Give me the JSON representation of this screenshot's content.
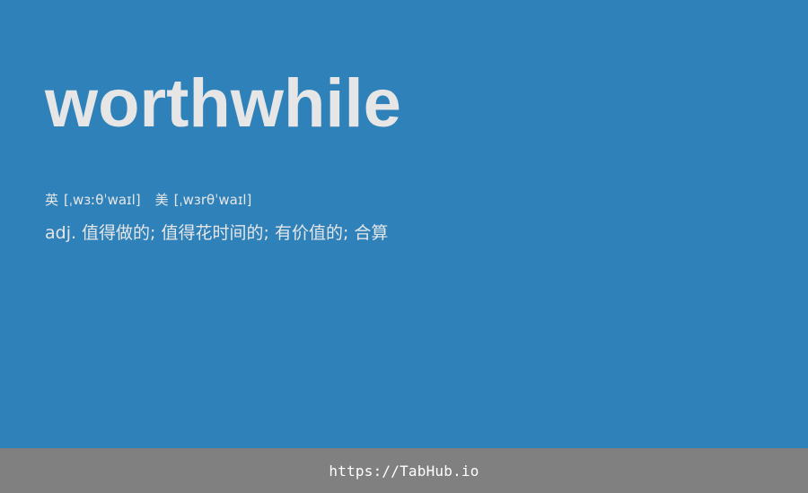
{
  "colors": {
    "background": "#2e81b9",
    "text": "#e6e6e6",
    "footer_background": "#808080",
    "footer_text": "#ffffff"
  },
  "entry": {
    "word": "worthwhile",
    "phonetics": [
      {
        "lang": "英",
        "ipa": "[ˌwɜːθˈwaɪl]"
      },
      {
        "lang": "美",
        "ipa": "[ˌwɜrθˈwaɪl]"
      }
    ],
    "definition": "adj. 值得做的; 值得花时间的; 有价值的; 合算"
  },
  "footer": {
    "link_text": "https://TabHub.io"
  }
}
